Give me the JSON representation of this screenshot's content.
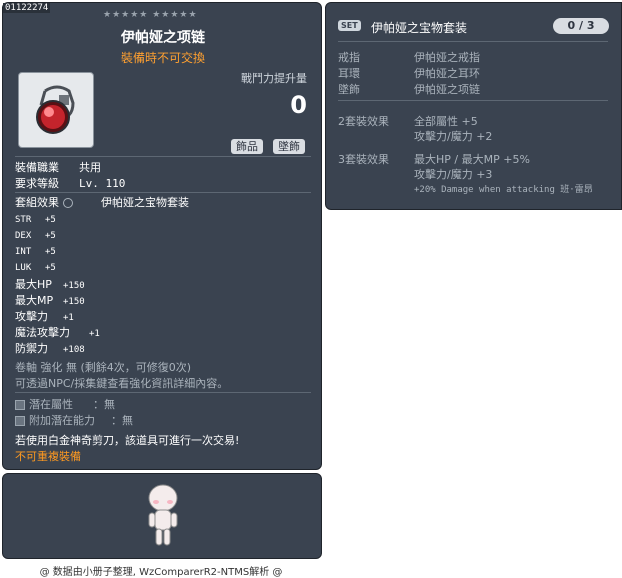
{
  "item": {
    "id": "01122274",
    "stars": "★★★★★ ★★★★★",
    "title": "伊帕娅之项链",
    "trade_note": "裝備時不可交換",
    "power_label": "戰鬥力提升量",
    "power_value": "0",
    "tags": [
      "飾品",
      "墜飾"
    ],
    "job_label": "裝備職業",
    "job_value": "共用",
    "level_label": "要求等級",
    "level_value": "Lv. 110",
    "set_effect_label": "套組效果",
    "set_name": "伊帕娅之宝物套装",
    "stats": [
      {
        "k": "STR",
        "v": "+5"
      },
      {
        "k": "DEX",
        "v": "+5"
      },
      {
        "k": "INT",
        "v": "+5"
      },
      {
        "k": "LUK",
        "v": "+5"
      },
      {
        "k": "最大HP",
        "v": "+150"
      },
      {
        "k": "最大MP",
        "v": "+150"
      },
      {
        "k": "攻擊力",
        "v": "+1"
      },
      {
        "k": "魔法攻擊力",
        "v": "+1"
      },
      {
        "k": "防禦力",
        "v": "+108"
      }
    ],
    "scroll_line": "卷軸 強化 無 (剩餘4次，可修復0次)",
    "enhance_note": "可透過NPC/採集鍵查看強化資訊詳細內容。",
    "potential_label": "潛在屬性",
    "potential_value": "無",
    "bonus_potential_label": "附加潛在能力",
    "bonus_potential_value": "無",
    "scissors_note": "若使用白金神奇剪刀，該道具可進行一次交易!",
    "no_duplicate": "不可重複裝備"
  },
  "set": {
    "badge": "SET",
    "title": "伊帕娅之宝物套装",
    "count": "0 / 3",
    "pieces": [
      {
        "slot": "戒指",
        "name": "伊帕娅之戒指"
      },
      {
        "slot": "耳環",
        "name": "伊帕娅之耳环"
      },
      {
        "slot": "墜飾",
        "name": "伊帕娅之项链"
      }
    ],
    "bonus2_label": "2套裝效果",
    "bonus2_lines": [
      "全部屬性  +5",
      "攻擊力/魔力 +2"
    ],
    "bonus3_label": "3套裝效果",
    "bonus3_lines": [
      "最大HP / 最大MP  +5%",
      "攻擊力/魔力 +3",
      "+20% Damage when attacking 班·雷昂"
    ]
  },
  "footer": "@ 数据由小册子整理, WzComparerR2-NTMS解析 @",
  "colors": {
    "panel": "#3a4350",
    "accent_orange": "#ffa030",
    "muted": "#aab3bc"
  },
  "icons": [
    "necklace-icon",
    "set-badge-icon",
    "character-preview-icon"
  ]
}
